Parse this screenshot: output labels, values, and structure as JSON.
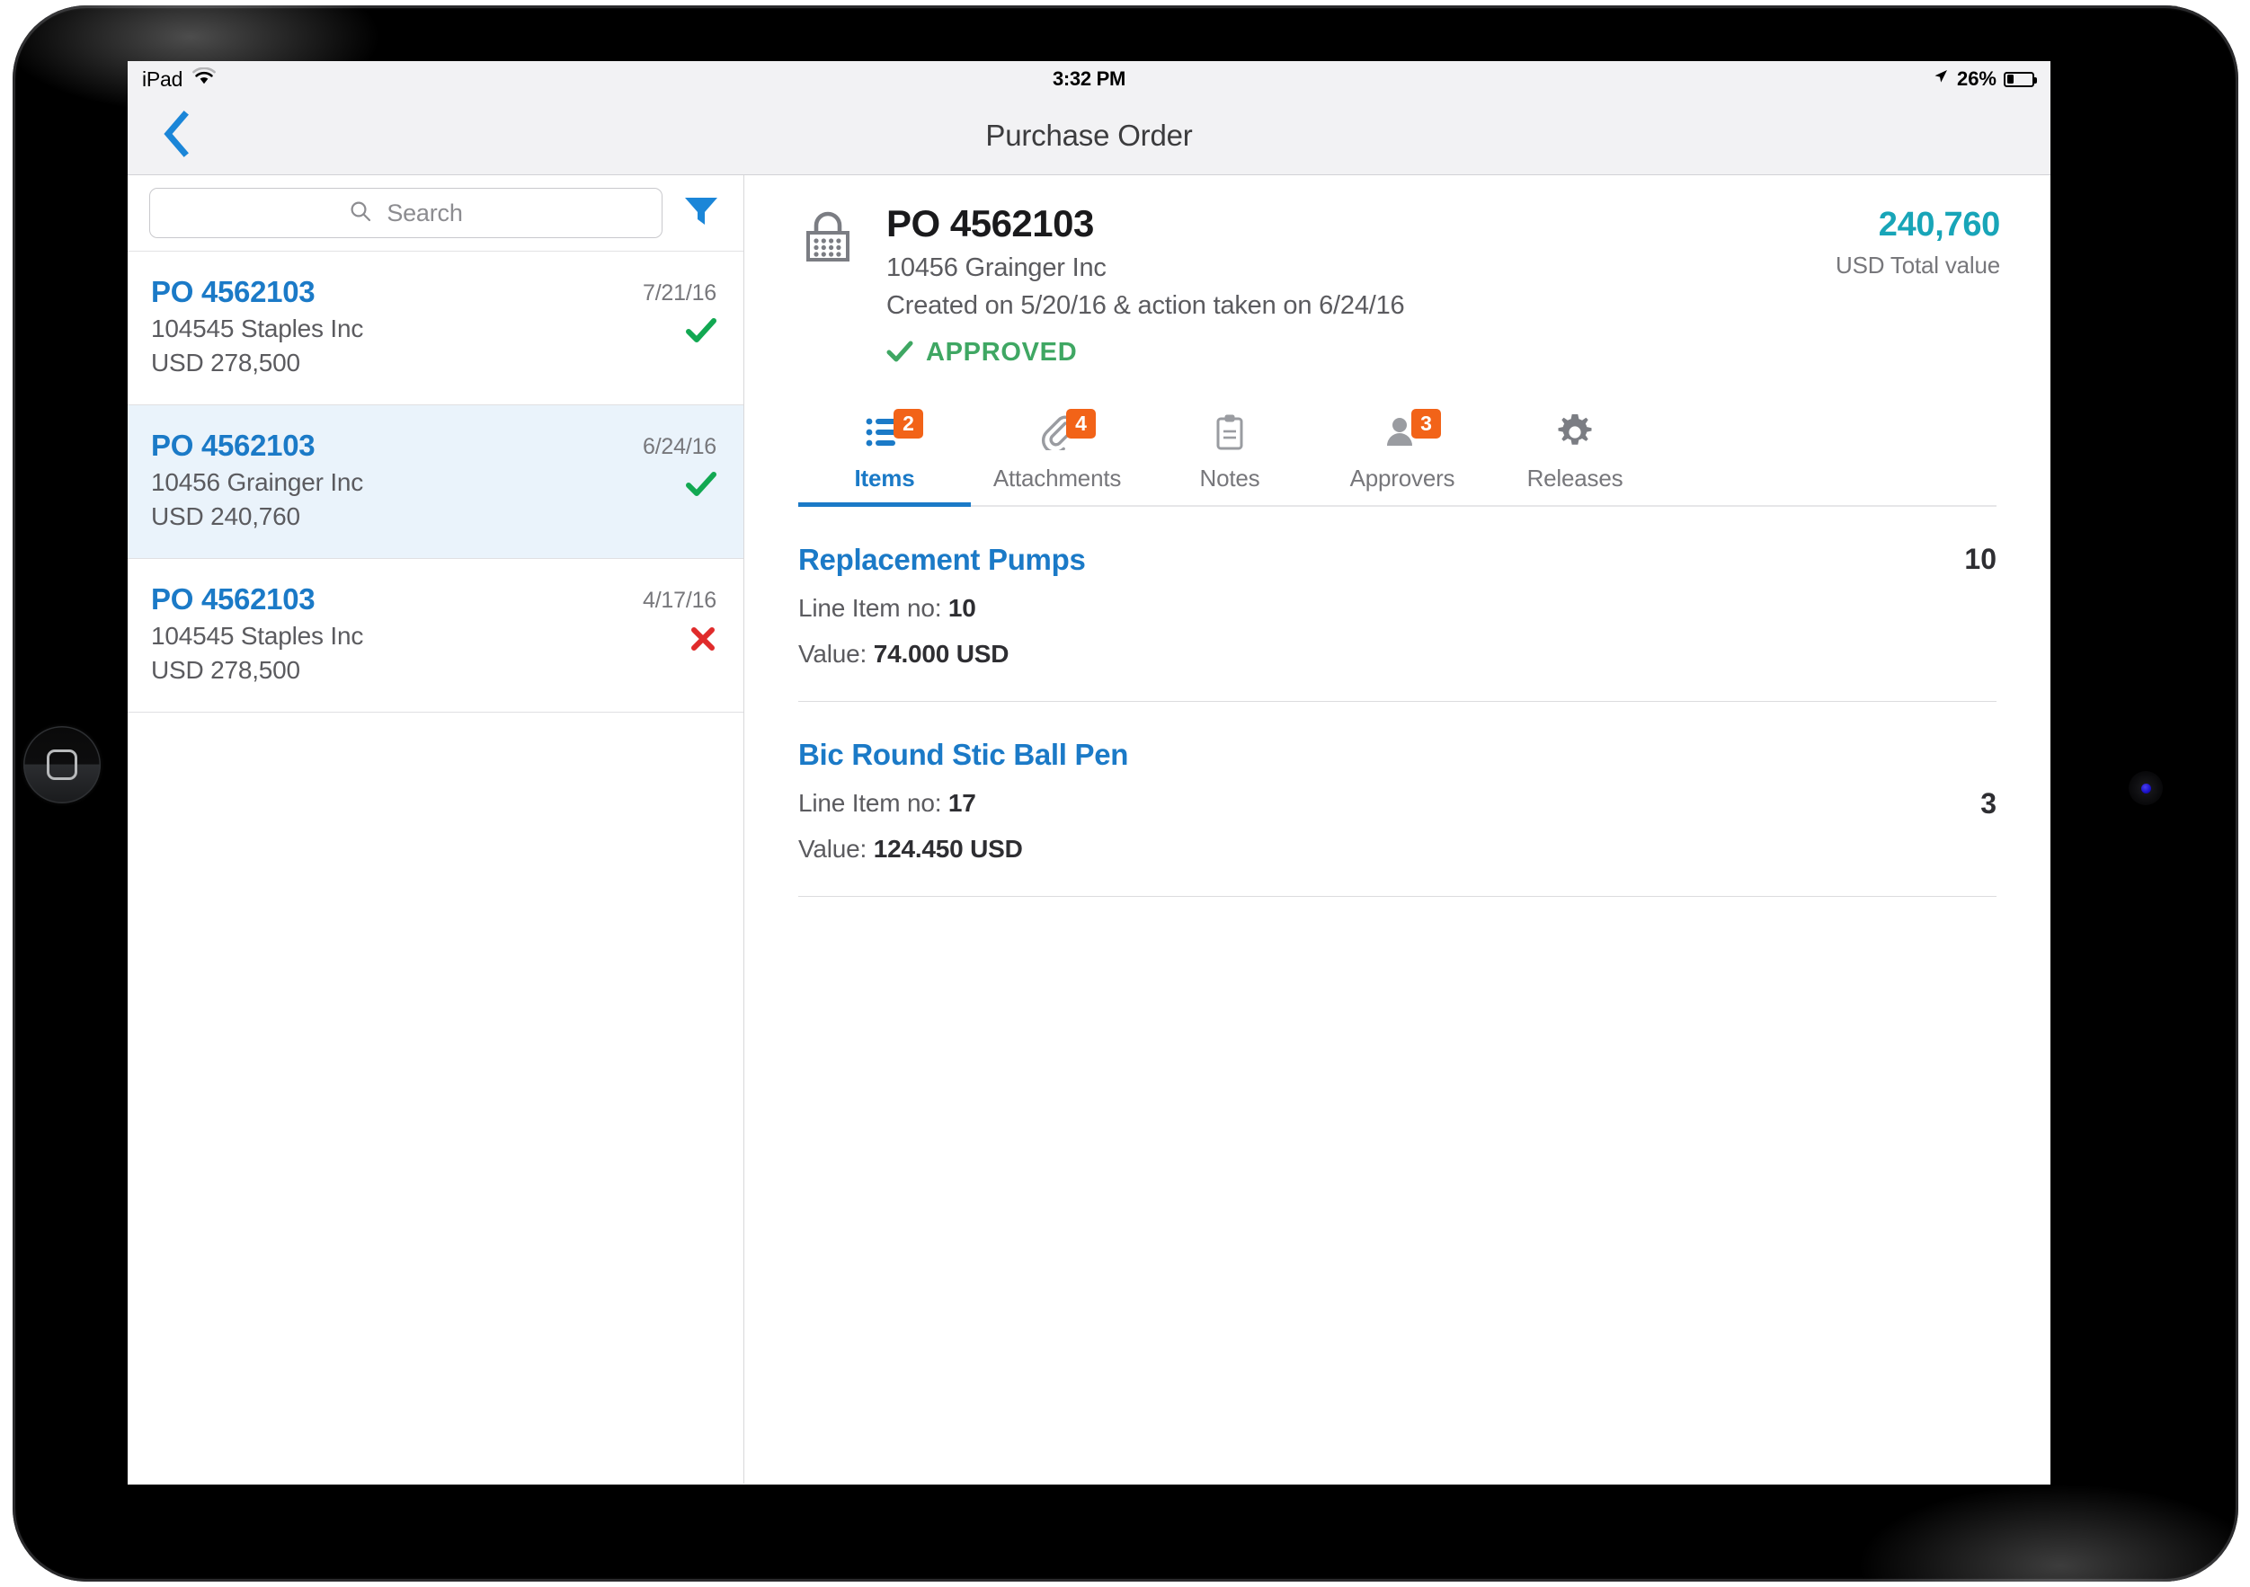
{
  "status_bar": {
    "carrier": "iPad",
    "wifi_icon": "wifi-icon",
    "time": "3:32 PM",
    "location_icon": "location-arrow-icon",
    "battery_percent": "26%",
    "battery_level": 26
  },
  "nav": {
    "back_icon": "chevron-left-icon",
    "title": "Purchase Order"
  },
  "search": {
    "placeholder": "Search",
    "value": "",
    "icon": "search-icon",
    "filter_icon": "filter-icon"
  },
  "po_list": [
    {
      "number": "PO 4562103",
      "date": "7/21/16",
      "vendor": "104545 Staples Inc",
      "amount": "USD 278,500",
      "status": "approved",
      "status_icon": "check-icon",
      "selected": false
    },
    {
      "number": "PO 4562103",
      "date": "6/24/16",
      "vendor": "10456 Grainger Inc",
      "amount": "USD 240,760",
      "status": "approved",
      "status_icon": "check-icon",
      "selected": true
    },
    {
      "number": "PO 4562103",
      "date": "4/17/16",
      "vendor": "104545 Staples Inc",
      "amount": "USD 278,500",
      "status": "rejected",
      "status_icon": "cross-icon",
      "selected": false
    }
  ],
  "detail": {
    "icon": "shopping-basket-icon",
    "po_number": "PO 4562103",
    "vendor": "10456 Grainger Inc",
    "dates": "Created on 5/20/16 & action taken on 6/24/16",
    "status_label": "APPROVED",
    "status_icon": "check-icon",
    "total_value": "240,760",
    "total_label": "USD Total value"
  },
  "tabs": [
    {
      "label": "Items",
      "icon": "list-icon",
      "badge": "2",
      "active": true
    },
    {
      "label": "Attachments",
      "icon": "paperclip-icon",
      "badge": "4",
      "active": false
    },
    {
      "label": "Notes",
      "icon": "clipboard-icon",
      "badge": null,
      "active": false
    },
    {
      "label": "Approvers",
      "icon": "person-icon",
      "badge": "3",
      "active": false
    },
    {
      "label": "Releases",
      "icon": "gear-icon",
      "badge": null,
      "active": false
    }
  ],
  "line_items": [
    {
      "title": "Replacement Pumps",
      "line_label": "Line Item no:",
      "line_number": "10",
      "value_label": "Value:",
      "value": "74.000 USD",
      "quantity": "10"
    },
    {
      "title": "Bic Round Stic Ball Pen",
      "line_label": "Line Item no:",
      "line_number": "17",
      "value_label": "Value:",
      "value": "124.450 USD",
      "quantity": "3"
    }
  ],
  "colors": {
    "accent_blue": "#1b7ac7",
    "teal": "#18a5b8",
    "green": "#12a852",
    "red": "#e02b2b",
    "orange_badge": "#f26318",
    "chrome_gray": "#f2f2f4"
  }
}
